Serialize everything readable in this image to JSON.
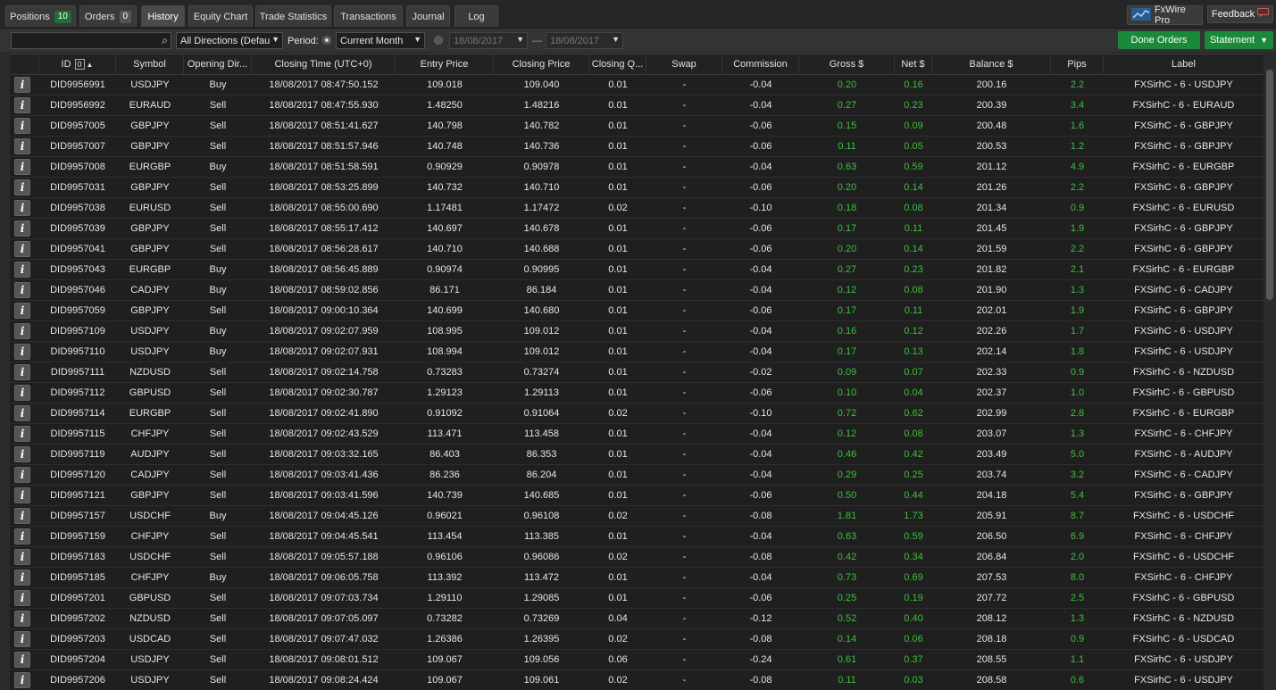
{
  "tabs": {
    "positions": {
      "label": "Positions",
      "count": "10"
    },
    "orders": {
      "label": "Orders",
      "count": "0"
    },
    "history": {
      "label": "History"
    },
    "equity_chart": {
      "label": "Equity Chart"
    },
    "trade_statistics": {
      "label": "Trade Statistics"
    },
    "transactions": {
      "label": "Transactions"
    },
    "journal": {
      "label": "Journal"
    },
    "log": {
      "label": "Log"
    }
  },
  "top_right": {
    "fxwire_label": "FxWire Pro",
    "feedback_label": "Feedback"
  },
  "filters": {
    "search_value": "",
    "direction": "All Directions (Default)",
    "period_label": "Period:",
    "period": "Current Month",
    "date_from": "18/08/2017",
    "date_to": "18/08/2017",
    "date_sep": "—",
    "done_orders_label": "Done Orders",
    "statement_label": "Statement"
  },
  "columns": {
    "id": "ID",
    "id_sort_badge": "0",
    "symbol": "Symbol",
    "opening_direction": "Opening Dir...",
    "closing_time": "Closing Time (UTC+0)",
    "entry_price": "Entry Price",
    "closing_price": "Closing Price",
    "closing_qty": "Closing Q...",
    "swap": "Swap",
    "commission": "Commission",
    "gross": "Gross $",
    "net": "Net $",
    "balance": "Balance $",
    "pips": "Pips",
    "label": "Label"
  },
  "info_glyph": "i",
  "rows": [
    {
      "id": "DID9956991",
      "symbol": "USDJPY",
      "dir": "Buy",
      "time": "18/08/2017 08:47:50.152",
      "entry": "109.018",
      "close": "109.040",
      "qty": "0.01",
      "swap": "-",
      "comm": "-0.04",
      "gross": "0.20",
      "net": "0.16",
      "balance": "200.16",
      "pips": "2.2",
      "label": "FXSirhC - 6 - USDJPY"
    },
    {
      "id": "DID9956992",
      "symbol": "EURAUD",
      "dir": "Sell",
      "time": "18/08/2017 08:47:55.930",
      "entry": "1.48250",
      "close": "1.48216",
      "qty": "0.01",
      "swap": "-",
      "comm": "-0.04",
      "gross": "0.27",
      "net": "0.23",
      "balance": "200.39",
      "pips": "3.4",
      "label": "FXSirhC - 6 - EURAUD"
    },
    {
      "id": "DID9957005",
      "symbol": "GBPJPY",
      "dir": "Sell",
      "time": "18/08/2017 08:51:41.627",
      "entry": "140.798",
      "close": "140.782",
      "qty": "0.01",
      "swap": "-",
      "comm": "-0.06",
      "gross": "0.15",
      "net": "0.09",
      "balance": "200.48",
      "pips": "1.6",
      "label": "FXSirhC - 6 - GBPJPY"
    },
    {
      "id": "DID9957007",
      "symbol": "GBPJPY",
      "dir": "Sell",
      "time": "18/08/2017 08:51:57.946",
      "entry": "140.748",
      "close": "140.736",
      "qty": "0.01",
      "swap": "-",
      "comm": "-0.06",
      "gross": "0.11",
      "net": "0.05",
      "balance": "200.53",
      "pips": "1.2",
      "label": "FXSirhC - 6 - GBPJPY"
    },
    {
      "id": "DID9957008",
      "symbol": "EURGBP",
      "dir": "Buy",
      "time": "18/08/2017 08:51:58.591",
      "entry": "0.90929",
      "close": "0.90978",
      "qty": "0.01",
      "swap": "-",
      "comm": "-0.04",
      "gross": "0.63",
      "net": "0.59",
      "balance": "201.12",
      "pips": "4.9",
      "label": "FXSirhC - 6 - EURGBP"
    },
    {
      "id": "DID9957031",
      "symbol": "GBPJPY",
      "dir": "Sell",
      "time": "18/08/2017 08:53:25.899",
      "entry": "140.732",
      "close": "140.710",
      "qty": "0.01",
      "swap": "-",
      "comm": "-0.06",
      "gross": "0.20",
      "net": "0.14",
      "balance": "201.26",
      "pips": "2.2",
      "label": "FXSirhC - 6 - GBPJPY"
    },
    {
      "id": "DID9957038",
      "symbol": "EURUSD",
      "dir": "Sell",
      "time": "18/08/2017 08:55:00.690",
      "entry": "1.17481",
      "close": "1.17472",
      "qty": "0.02",
      "swap": "-",
      "comm": "-0.10",
      "gross": "0.18",
      "net": "0.08",
      "balance": "201.34",
      "pips": "0.9",
      "label": "FXSirhC - 6 - EURUSD"
    },
    {
      "id": "DID9957039",
      "symbol": "GBPJPY",
      "dir": "Sell",
      "time": "18/08/2017 08:55:17.412",
      "entry": "140.697",
      "close": "140.678",
      "qty": "0.01",
      "swap": "-",
      "comm": "-0.06",
      "gross": "0.17",
      "net": "0.11",
      "balance": "201.45",
      "pips": "1.9",
      "label": "FXSirhC - 6 - GBPJPY"
    },
    {
      "id": "DID9957041",
      "symbol": "GBPJPY",
      "dir": "Sell",
      "time": "18/08/2017 08:56:28.617",
      "entry": "140.710",
      "close": "140.688",
      "qty": "0.01",
      "swap": "-",
      "comm": "-0.06",
      "gross": "0.20",
      "net": "0.14",
      "balance": "201.59",
      "pips": "2.2",
      "label": "FXSirhC - 6 - GBPJPY"
    },
    {
      "id": "DID9957043",
      "symbol": "EURGBP",
      "dir": "Buy",
      "time": "18/08/2017 08:56:45.889",
      "entry": "0.90974",
      "close": "0.90995",
      "qty": "0.01",
      "swap": "-",
      "comm": "-0.04",
      "gross": "0.27",
      "net": "0.23",
      "balance": "201.82",
      "pips": "2.1",
      "label": "FXSirhC - 6 - EURGBP"
    },
    {
      "id": "DID9957046",
      "symbol": "CADJPY",
      "dir": "Buy",
      "time": "18/08/2017 08:59:02.856",
      "entry": "86.171",
      "close": "86.184",
      "qty": "0.01",
      "swap": "-",
      "comm": "-0.04",
      "gross": "0.12",
      "net": "0.08",
      "balance": "201.90",
      "pips": "1.3",
      "label": "FXSirhC - 6 - CADJPY"
    },
    {
      "id": "DID9957059",
      "symbol": "GBPJPY",
      "dir": "Sell",
      "time": "18/08/2017 09:00:10.364",
      "entry": "140.699",
      "close": "140.680",
      "qty": "0.01",
      "swap": "-",
      "comm": "-0.06",
      "gross": "0.17",
      "net": "0.11",
      "balance": "202.01",
      "pips": "1.9",
      "label": "FXSirhC - 6 - GBPJPY"
    },
    {
      "id": "DID9957109",
      "symbol": "USDJPY",
      "dir": "Buy",
      "time": "18/08/2017 09:02:07.959",
      "entry": "108.995",
      "close": "109.012",
      "qty": "0.01",
      "swap": "-",
      "comm": "-0.04",
      "gross": "0.16",
      "net": "0.12",
      "balance": "202.26",
      "pips": "1.7",
      "label": "FXSirhC - 6 - USDJPY"
    },
    {
      "id": "DID9957110",
      "symbol": "USDJPY",
      "dir": "Buy",
      "time": "18/08/2017 09:02:07.931",
      "entry": "108.994",
      "close": "109.012",
      "qty": "0.01",
      "swap": "-",
      "comm": "-0.04",
      "gross": "0.17",
      "net": "0.13",
      "balance": "202.14",
      "pips": "1.8",
      "label": "FXSirhC - 6 - USDJPY"
    },
    {
      "id": "DID9957111",
      "symbol": "NZDUSD",
      "dir": "Sell",
      "time": "18/08/2017 09:02:14.758",
      "entry": "0.73283",
      "close": "0.73274",
      "qty": "0.01",
      "swap": "-",
      "comm": "-0.02",
      "gross": "0.09",
      "net": "0.07",
      "balance": "202.33",
      "pips": "0.9",
      "label": "FXSirhC - 6 - NZDUSD"
    },
    {
      "id": "DID9957112",
      "symbol": "GBPUSD",
      "dir": "Sell",
      "time": "18/08/2017 09:02:30.787",
      "entry": "1.29123",
      "close": "1.29113",
      "qty": "0.01",
      "swap": "-",
      "comm": "-0.06",
      "gross": "0.10",
      "net": "0.04",
      "balance": "202.37",
      "pips": "1.0",
      "label": "FXSirhC - 6 - GBPUSD"
    },
    {
      "id": "DID9957114",
      "symbol": "EURGBP",
      "dir": "Sell",
      "time": "18/08/2017 09:02:41.890",
      "entry": "0.91092",
      "close": "0.91064",
      "qty": "0.02",
      "swap": "-",
      "comm": "-0.10",
      "gross": "0.72",
      "net": "0.62",
      "balance": "202.99",
      "pips": "2.8",
      "label": "FXSirhC - 6 - EURGBP"
    },
    {
      "id": "DID9957115",
      "symbol": "CHFJPY",
      "dir": "Sell",
      "time": "18/08/2017 09:02:43.529",
      "entry": "113.471",
      "close": "113.458",
      "qty": "0.01",
      "swap": "-",
      "comm": "-0.04",
      "gross": "0.12",
      "net": "0.08",
      "balance": "203.07",
      "pips": "1.3",
      "label": "FXSirhC - 6 - CHFJPY"
    },
    {
      "id": "DID9957119",
      "symbol": "AUDJPY",
      "dir": "Sell",
      "time": "18/08/2017 09:03:32.165",
      "entry": "86.403",
      "close": "86.353",
      "qty": "0.01",
      "swap": "-",
      "comm": "-0.04",
      "gross": "0.46",
      "net": "0.42",
      "balance": "203.49",
      "pips": "5.0",
      "label": "FXSirhC - 6 - AUDJPY"
    },
    {
      "id": "DID9957120",
      "symbol": "CADJPY",
      "dir": "Sell",
      "time": "18/08/2017 09:03:41.436",
      "entry": "86.236",
      "close": "86.204",
      "qty": "0.01",
      "swap": "-",
      "comm": "-0.04",
      "gross": "0.29",
      "net": "0.25",
      "balance": "203.74",
      "pips": "3.2",
      "label": "FXSirhC - 6 - CADJPY"
    },
    {
      "id": "DID9957121",
      "symbol": "GBPJPY",
      "dir": "Sell",
      "time": "18/08/2017 09:03:41.596",
      "entry": "140.739",
      "close": "140.685",
      "qty": "0.01",
      "swap": "-",
      "comm": "-0.06",
      "gross": "0.50",
      "net": "0.44",
      "balance": "204.18",
      "pips": "5.4",
      "label": "FXSirhC - 6 - GBPJPY"
    },
    {
      "id": "DID9957157",
      "symbol": "USDCHF",
      "dir": "Buy",
      "time": "18/08/2017 09:04:45.126",
      "entry": "0.96021",
      "close": "0.96108",
      "qty": "0.02",
      "swap": "-",
      "comm": "-0.08",
      "gross": "1.81",
      "net": "1.73",
      "balance": "205.91",
      "pips": "8.7",
      "label": "FXSirhC - 6 - USDCHF"
    },
    {
      "id": "DID9957159",
      "symbol": "CHFJPY",
      "dir": "Sell",
      "time": "18/08/2017 09:04:45.541",
      "entry": "113.454",
      "close": "113.385",
      "qty": "0.01",
      "swap": "-",
      "comm": "-0.04",
      "gross": "0.63",
      "net": "0.59",
      "balance": "206.50",
      "pips": "6.9",
      "label": "FXSirhC - 6 - CHFJPY"
    },
    {
      "id": "DID9957183",
      "symbol": "USDCHF",
      "dir": "Sell",
      "time": "18/08/2017 09:05:57.188",
      "entry": "0.96106",
      "close": "0.96086",
      "qty": "0.02",
      "swap": "-",
      "comm": "-0.08",
      "gross": "0.42",
      "net": "0.34",
      "balance": "206.84",
      "pips": "2.0",
      "label": "FXSirhC - 6 - USDCHF"
    },
    {
      "id": "DID9957185",
      "symbol": "CHFJPY",
      "dir": "Buy",
      "time": "18/08/2017 09:06:05.758",
      "entry": "113.392",
      "close": "113.472",
      "qty": "0.01",
      "swap": "-",
      "comm": "-0.04",
      "gross": "0.73",
      "net": "0.69",
      "balance": "207.53",
      "pips": "8.0",
      "label": "FXSirhC - 6 - CHFJPY"
    },
    {
      "id": "DID9957201",
      "symbol": "GBPUSD",
      "dir": "Sell",
      "time": "18/08/2017 09:07:03.734",
      "entry": "1.29110",
      "close": "1.29085",
      "qty": "0.01",
      "swap": "-",
      "comm": "-0.06",
      "gross": "0.25",
      "net": "0.19",
      "balance": "207.72",
      "pips": "2.5",
      "label": "FXSirhC - 6 - GBPUSD"
    },
    {
      "id": "DID9957202",
      "symbol": "NZDUSD",
      "dir": "Sell",
      "time": "18/08/2017 09:07:05.097",
      "entry": "0.73282",
      "close": "0.73269",
      "qty": "0.04",
      "swap": "-",
      "comm": "-0.12",
      "gross": "0.52",
      "net": "0.40",
      "balance": "208.12",
      "pips": "1.3",
      "label": "FXSirhC - 6 - NZDUSD"
    },
    {
      "id": "DID9957203",
      "symbol": "USDCAD",
      "dir": "Sell",
      "time": "18/08/2017 09:07:47.032",
      "entry": "1.26386",
      "close": "1.26395",
      "qty": "0.02",
      "swap": "-",
      "comm": "-0.08",
      "gross": "0.14",
      "net": "0.06",
      "balance": "208.18",
      "pips": "0.9",
      "label": "FXSirhC - 6 - USDCAD"
    },
    {
      "id": "DID9957204",
      "symbol": "USDJPY",
      "dir": "Sell",
      "time": "18/08/2017 09:08:01.512",
      "entry": "109.067",
      "close": "109.056",
      "qty": "0.06",
      "swap": "-",
      "comm": "-0.24",
      "gross": "0.61",
      "net": "0.37",
      "balance": "208.55",
      "pips": "1.1",
      "label": "FXSirhC - 6 - USDJPY"
    },
    {
      "id": "DID9957206",
      "symbol": "USDJPY",
      "dir": "Sell",
      "time": "18/08/2017 09:08:24.424",
      "entry": "109.067",
      "close": "109.061",
      "qty": "0.02",
      "swap": "-",
      "comm": "-0.08",
      "gross": "0.11",
      "net": "0.03",
      "balance": "208.58",
      "pips": "0.6",
      "label": "FXSirhC - 6 - USDJPY"
    }
  ]
}
